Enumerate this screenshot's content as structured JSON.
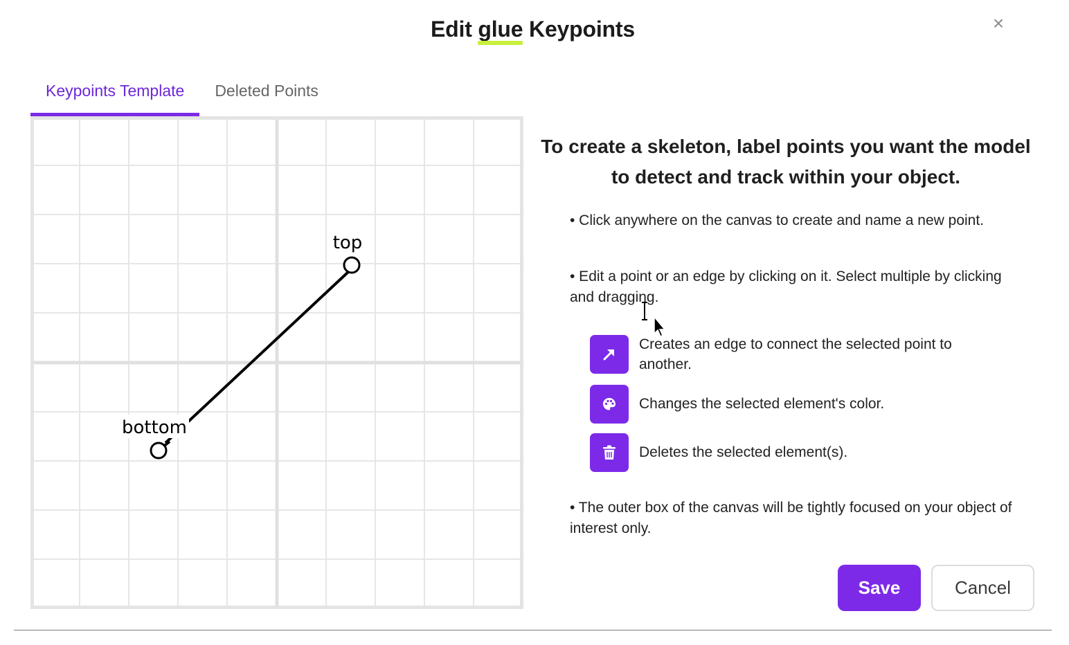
{
  "dialog": {
    "title_prefix": "Edit ",
    "title_highlight": "glue",
    "title_suffix": " Keypoints",
    "close_label": "×"
  },
  "tabs": [
    {
      "label": "Keypoints Template",
      "active": true
    },
    {
      "label": "Deleted Points",
      "active": false
    }
  ],
  "canvas": {
    "points": [
      {
        "label": "top"
      },
      {
        "label": "bottom"
      }
    ],
    "edges": [
      {
        "from": "bottom",
        "to": "top"
      }
    ]
  },
  "instructions": {
    "headline": "To create a skeleton, label points you want the model to detect and track within your object.",
    "bullet_create": "• Click anywhere on the canvas to create and name a new point.",
    "bullet_edit": "• Edit a point or an edge by clicking on it. Select multiple by clicking and dragging.",
    "tools": [
      {
        "icon": "arrow-icon",
        "text": "Creates an edge to connect the selected point to another."
      },
      {
        "icon": "palette-icon",
        "text": "Changes the selected element's color."
      },
      {
        "icon": "trash-icon",
        "text": "Deletes the selected element(s)."
      }
    ],
    "bullet_outer_box": "• The outer box of the canvas will be tightly focused on your object of interest only."
  },
  "footer": {
    "save_label": "Save",
    "cancel_label": "Cancel"
  },
  "colors": {
    "accent": "#7c2ae8",
    "highlight": "#c8f03c",
    "grid_line": "#e4e4e4"
  }
}
